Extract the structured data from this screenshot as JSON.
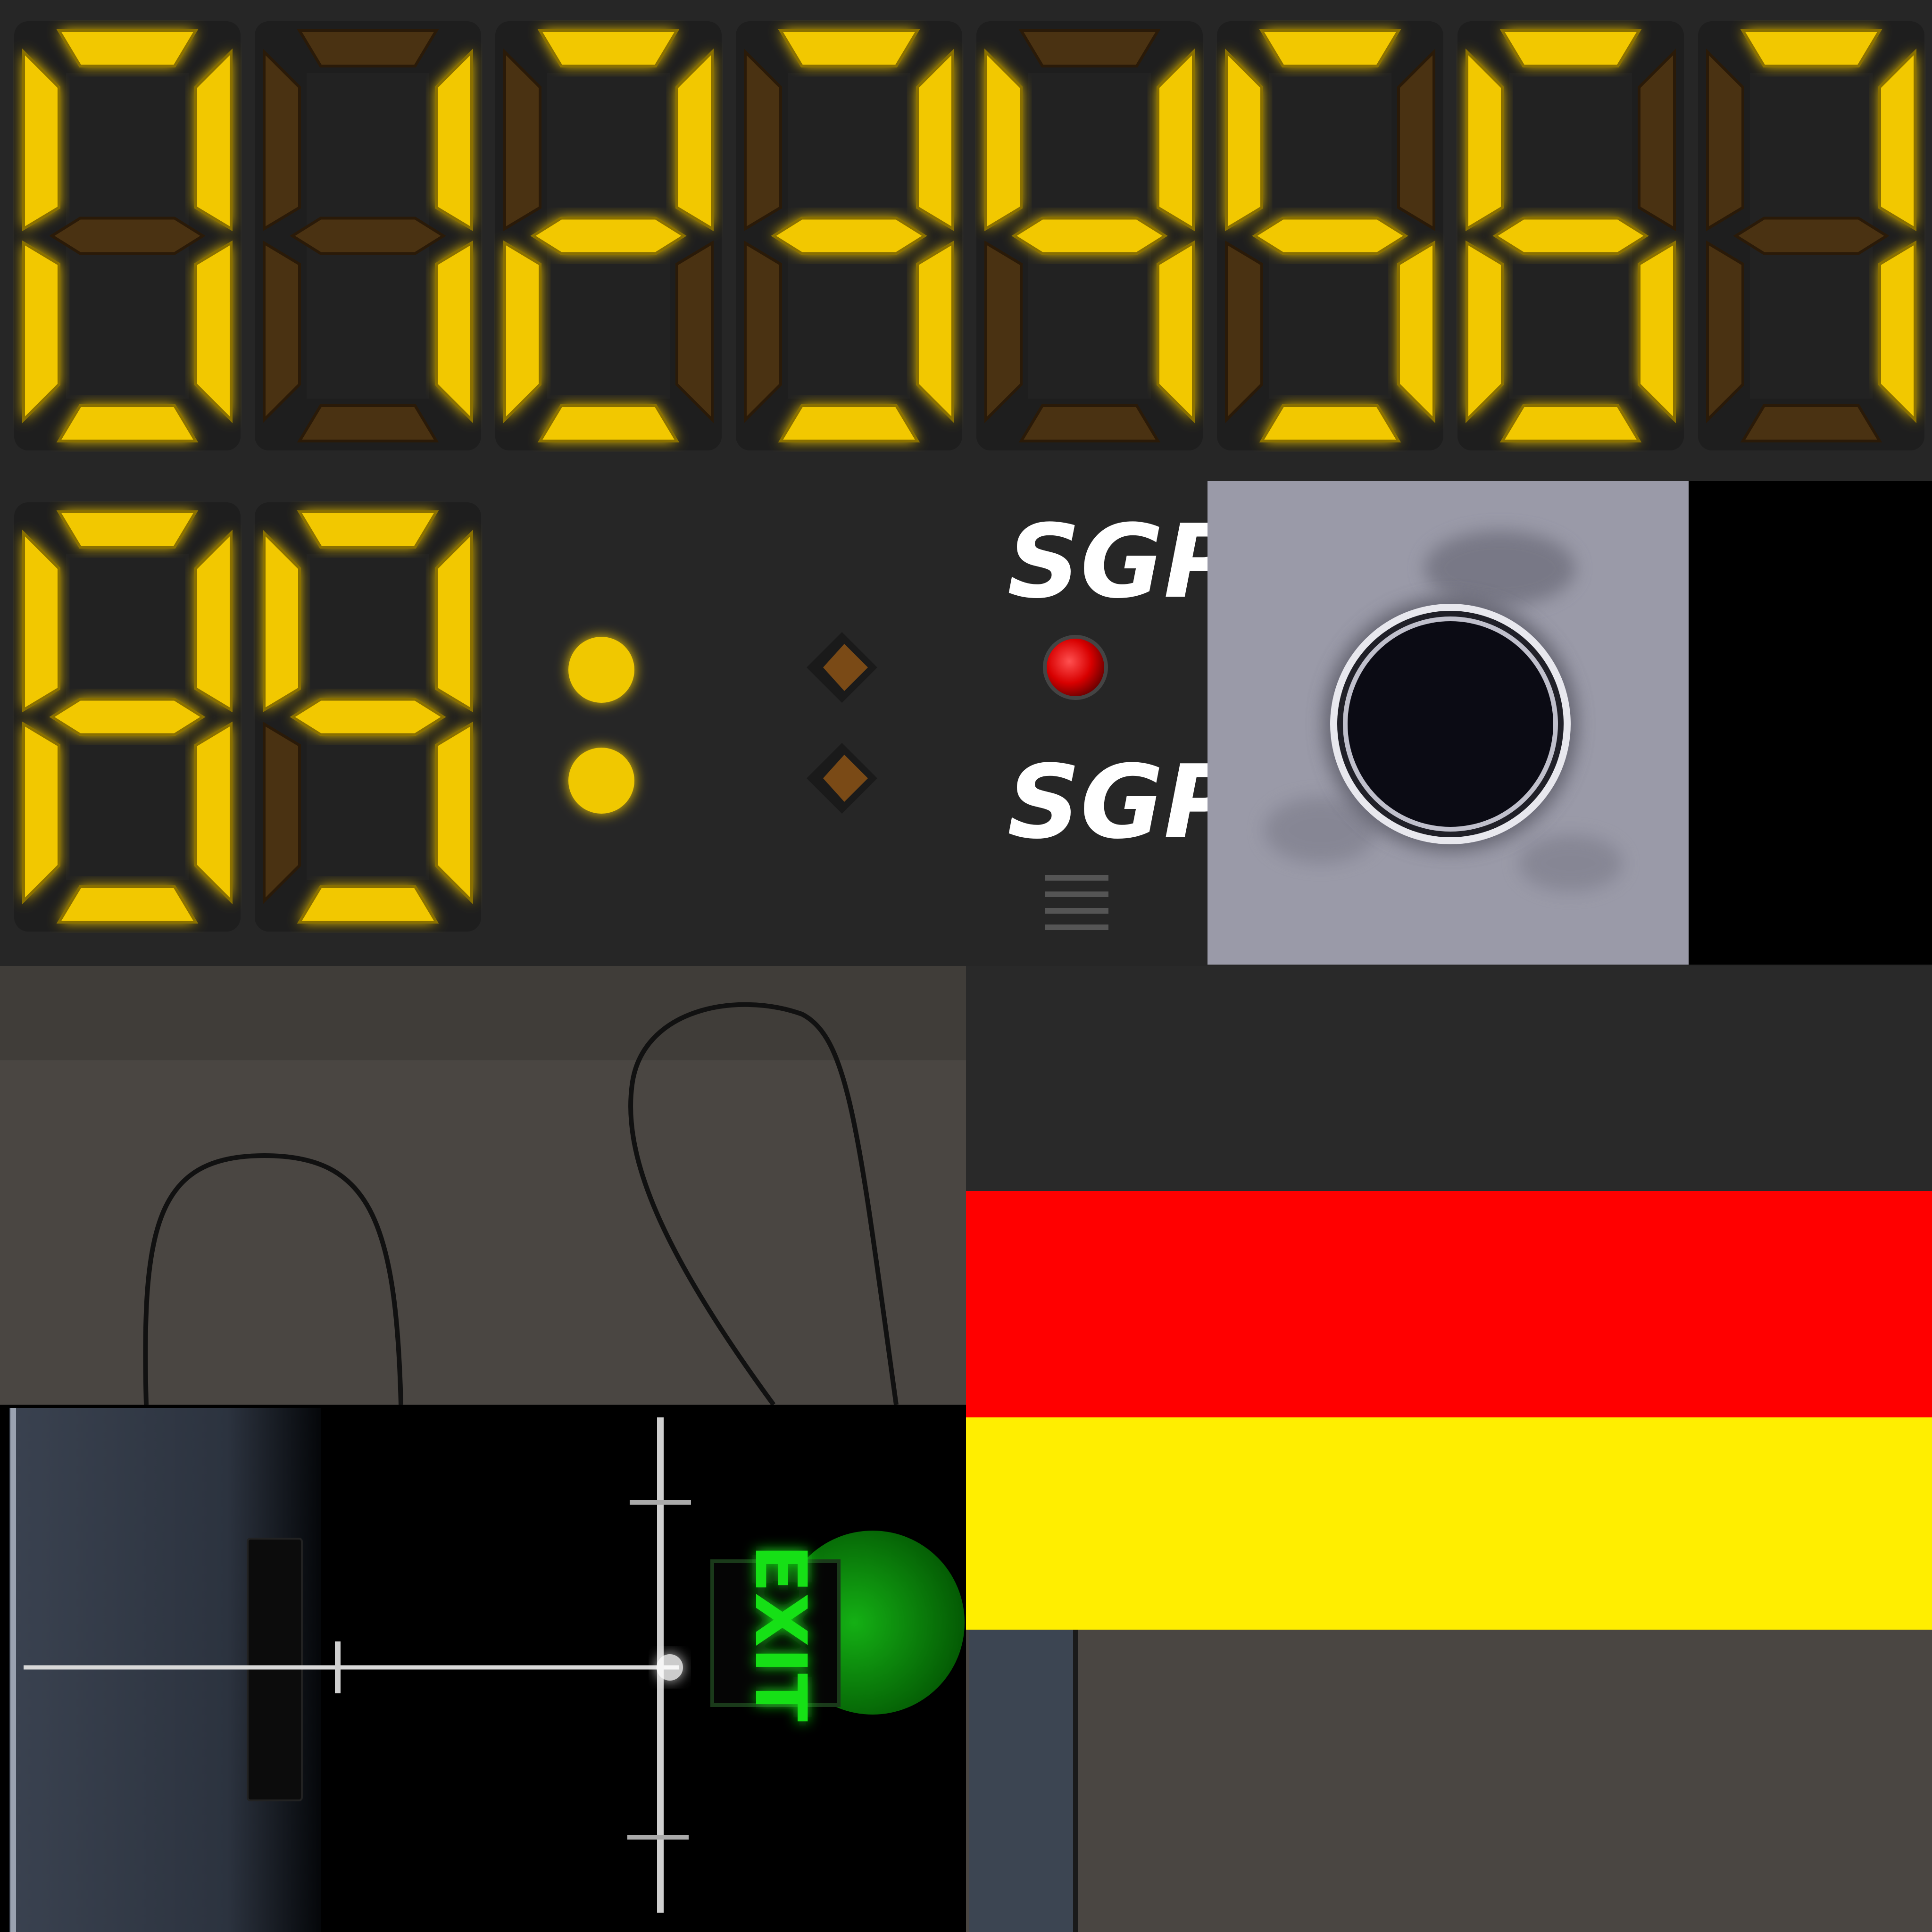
{
  "texture": {
    "digits_row1": [
      "0",
      "1",
      "2",
      "3",
      "4",
      "5",
      "6",
      "7"
    ],
    "digits_row2": [
      "8",
      "9"
    ],
    "logo_top": "SGP",
    "logo_bottom": "SGP",
    "exit_sign": "EXIT",
    "flag_stripes": [
      "black",
      "red",
      "yellow"
    ]
  },
  "colors": {
    "panel": "#2a2a2a",
    "segment_on": "#f2c800",
    "segment_off": "#4a3212",
    "led_red": "#e00000",
    "led_yellow": "#f0c800",
    "exit_green": "#16e016",
    "flag_red": "#ff0000",
    "flag_yellow": "#ffee00",
    "flag_black": "#2a2a2a"
  }
}
